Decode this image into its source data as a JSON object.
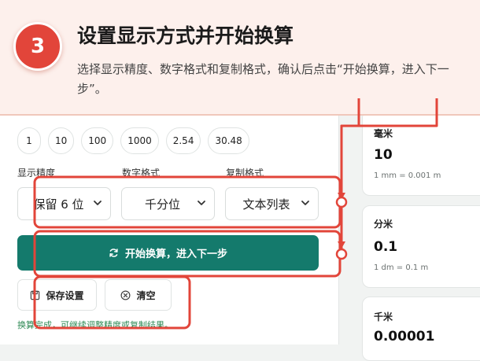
{
  "tutorial": {
    "step": "3",
    "title": "设置显示方式并开始换算",
    "description": "选择显示精度、数字格式和复制格式，确认后点击“开始换算，进入下一步”。"
  },
  "presets": [
    "1",
    "10",
    "100",
    "1000",
    "2.54",
    "30.48"
  ],
  "fields": {
    "precision": {
      "label": "显示精度",
      "value": "保留 6 位"
    },
    "number_format": {
      "label": "数字格式",
      "value": "千分位"
    },
    "copy_format": {
      "label": "复制格式",
      "value": "文本列表"
    }
  },
  "buttons": {
    "convert": "开始换算，进入下一步",
    "save": "保存设置",
    "clear": "清空"
  },
  "status": "换算完成，可继续调整精度或复制结果。",
  "results": [
    {
      "name": "毫米",
      "value": "10",
      "note": "1 mm = 0.001 m"
    },
    {
      "name": "分米",
      "value": "0.1",
      "note": "1 dm = 0.1 m"
    },
    {
      "name": "千米",
      "value": "0.00001",
      "note": ""
    }
  ],
  "colors": {
    "accent": "#147a6c",
    "annotation": "#e2453a",
    "status": "#2f8a55"
  }
}
